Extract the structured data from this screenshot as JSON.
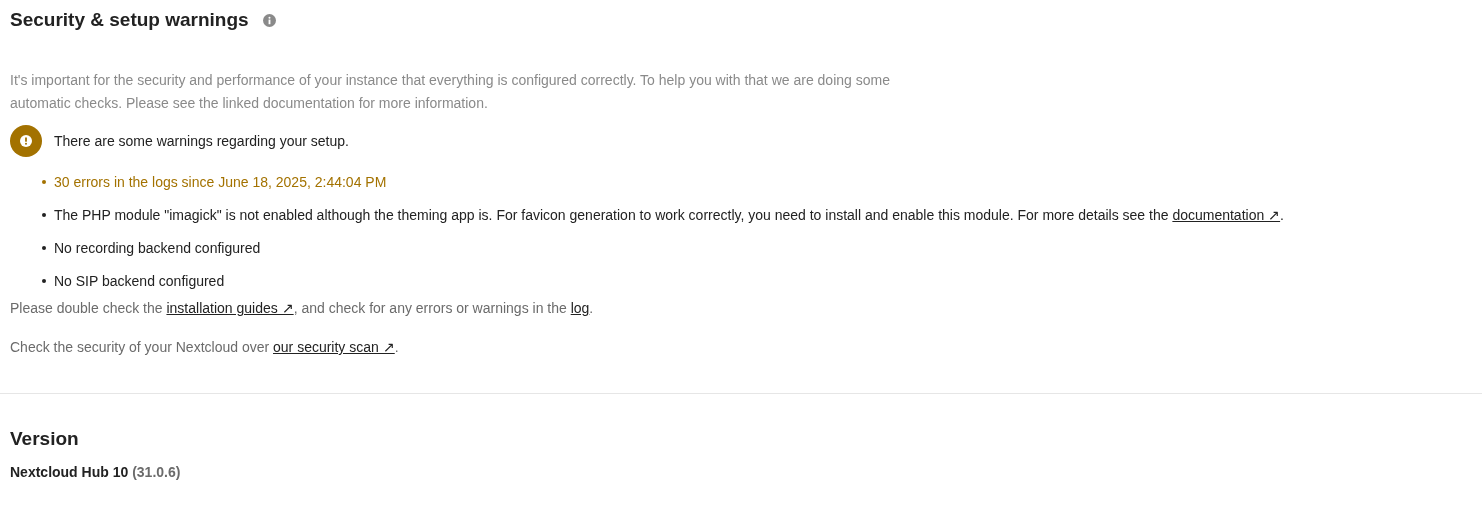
{
  "security": {
    "title": "Security & setup warnings",
    "description": "It's important for the security and performance of your instance that everything is configured correctly. To help you with that we are doing some automatic checks. Please see the linked documentation for more information.",
    "status": "There are some warnings regarding your setup.",
    "warnings": [
      {
        "color": "#a37200",
        "parts": [
          {
            "text": "30 errors in the logs since June 18, 2025, 2:44:04 PM"
          }
        ]
      },
      {
        "color": "#222222",
        "parts": [
          {
            "text": "The PHP module \"imagick\" is not enabled although the theming app is. For favicon generation to work correctly, you need to install and enable this module. For more details see the "
          },
          {
            "link": "documentation ↗"
          },
          {
            "text": "."
          }
        ]
      },
      {
        "color": "#222222",
        "parts": [
          {
            "text": "No recording backend configured"
          }
        ]
      },
      {
        "color": "#222222",
        "parts": [
          {
            "text": "No SIP backend configured"
          }
        ]
      }
    ],
    "notes": [
      {
        "parts": [
          {
            "text": "Please double check the "
          },
          {
            "link": "installation guides ↗"
          },
          {
            "text": ", and check for any errors or warnings in the "
          },
          {
            "link": "log"
          },
          {
            "text": "."
          }
        ]
      },
      {
        "parts": [
          {
            "text": "Check the security of your Nextcloud over "
          },
          {
            "link": "our security scan ↗"
          },
          {
            "text": "."
          }
        ]
      }
    ]
  },
  "version": {
    "title": "Version",
    "name": "Nextcloud Hub 10",
    "number": "(31.0.6)"
  }
}
